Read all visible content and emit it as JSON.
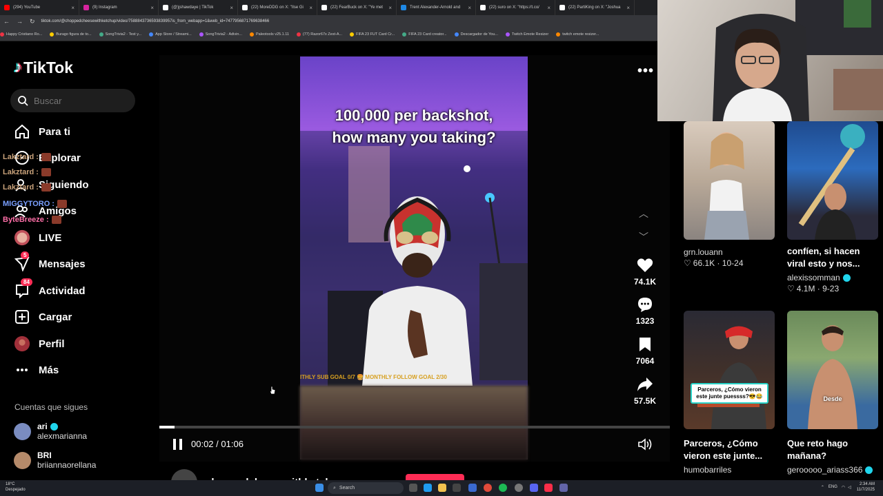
{
  "browser": {
    "tabs": [
      {
        "title": "(294) YouTube",
        "color": "#ff0000"
      },
      {
        "title": "(9) Instagram",
        "color": "#d6249f"
      },
      {
        "title": "(@)jshawdaye | TikTok",
        "color": "#ffffff"
      },
      {
        "title": "(22) MoreDDG on X: \"Ilse Gi",
        "color": "#ffffff"
      },
      {
        "title": "(22) FearBuck on X: \"Ye met",
        "color": "#ffffff"
      },
      {
        "title": "Trent Alexander-Arnold and",
        "color": "#1e88e5"
      },
      {
        "title": "(22) suro on X: \"https://t.co/",
        "color": "#ffffff"
      },
      {
        "title": "(22) PartiKing on X: \"Joshua",
        "color": "#ffffff"
      }
    ],
    "url": "tiktok.com/@choppedcheesewithketchup/video/7588843736593839957is_from_webapp=1&web_id=7477956871769638466",
    "bookmarks": [
      "Happy Cristiano Ro...",
      "Burago figura de to...",
      "SongTrivia2 - Test y...",
      "App Store / Streami...",
      "SongTrivia2 - Adivin...",
      "Paleotools v25.1.11",
      "(77) Razor67x Zest-A...",
      "FIFA 23 FUT Card Cr...",
      "FIFA 23 Card creator...",
      "Descargador de You...",
      "Twitch Emote Resizer",
      "twitch emote resizer..."
    ]
  },
  "sidebar": {
    "logo": "TikTok",
    "search_placeholder": "Buscar",
    "nav": [
      {
        "label": "Para ti",
        "icon": "home-icon"
      },
      {
        "label": "Explorar",
        "icon": "compass-icon"
      },
      {
        "label": "Siguiendo",
        "icon": "following-icon"
      },
      {
        "label": "Amigos",
        "icon": "friends-icon"
      },
      {
        "label": "LIVE",
        "icon": "live-icon"
      },
      {
        "label": "Mensajes",
        "icon": "messages-icon",
        "badge": "5"
      },
      {
        "label": "Actividad",
        "icon": "activity-icon",
        "badge": "84"
      },
      {
        "label": "Cargar",
        "icon": "upload-icon"
      },
      {
        "label": "Perfil",
        "icon": "profile-icon"
      },
      {
        "label": "Más",
        "icon": "more-icon"
      }
    ],
    "following_header": "Cuentas que sigues",
    "accounts": [
      {
        "name": "ari",
        "handle": "alexmarianna",
        "verified": true
      },
      {
        "name": "BRI",
        "handle": "briiannaorellana",
        "verified": false
      }
    ]
  },
  "chat_overlay": [
    {
      "user": "Lakztard :",
      "color": "#c9a27a"
    },
    {
      "user": "Lakztard :",
      "color": "#c9a27a"
    },
    {
      "user": "Lakztard :",
      "color": "#c9a27a"
    },
    {
      "user": "MIGGYTORO :",
      "color": "#7aa0ff"
    },
    {
      "user": "ByteBreeze :",
      "color": "#ff6fa8"
    }
  ],
  "video": {
    "caption_line1": "100,000 per backshot,",
    "caption_line2": "how many you taking?",
    "ticker": "ITHLY SUB GOAL 0/7  🍔  MONTHLY FOLLOW GOAL 2/30",
    "time_current": "00:02",
    "time_total": "01:06",
    "progress": 0.03,
    "author": "choppedcheesewithketchup",
    "actions": {
      "likes": "74.1K",
      "comments": "1323",
      "saves": "7064",
      "shares": "57.5K"
    }
  },
  "recommendations": [
    {
      "user": "grn.louann",
      "likes": "66.1K",
      "date": "10-24",
      "title": ""
    },
    {
      "title": "confíen, si hacen viral esto y nos...",
      "user": "alexissomman",
      "likes": "4.1M",
      "date": "9-23",
      "verified": true
    },
    {
      "title": "Parceros, ¿Cómo vieron este junte...",
      "user": "humobarriles",
      "overlay": "Parceros, ¿Cómo vieron este junte puessss?😎😂"
    },
    {
      "title": "Que reto hago mañana?",
      "user": "gerooooo_ariass366",
      "verified": true,
      "overlay": "Desde"
    }
  ],
  "taskbar": {
    "weather_temp": "18°C",
    "weather_desc": "Despejado",
    "search": "Search",
    "lang": "ENG",
    "time": "2:34 AM",
    "date": "11/7/2025"
  }
}
